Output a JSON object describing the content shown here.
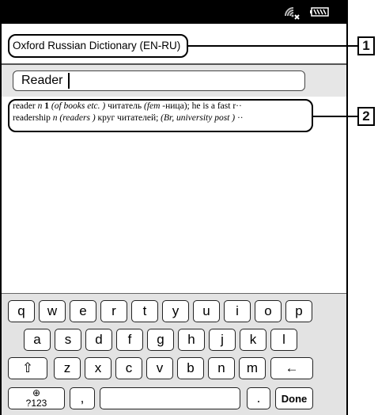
{
  "status_bar": {
    "wifi_icon": "wifi-off-icon",
    "battery_icon": "battery-icon"
  },
  "dictionary": {
    "title": "Oxford Russian Dictionary (EN-RU)"
  },
  "search": {
    "value": "Reader"
  },
  "results": [
    {
      "headword": "reader",
      "pos": "n",
      "sense": "1",
      "gloss_italic_1": "(of books etc. )",
      "translation": "читатель",
      "gloss_italic_2": "(fem",
      "form": "-ница);",
      "rest": "he is a fast r",
      "ellipsis": "··"
    },
    {
      "headword": "readership",
      "pos": "n",
      "gloss_italic_1": "(readers )",
      "translation": "круг читателей;",
      "gloss_italic_2": "(Br, university post )",
      "ellipsis": "··"
    }
  ],
  "keyboard": {
    "row1": [
      "q",
      "w",
      "e",
      "r",
      "t",
      "y",
      "u",
      "i",
      "o",
      "p"
    ],
    "row2": [
      "a",
      "s",
      "d",
      "f",
      "g",
      "h",
      "j",
      "k",
      "l"
    ],
    "row3_letters": [
      "z",
      "x",
      "c",
      "v",
      "b",
      "n",
      "m"
    ],
    "shift_label": "⇧",
    "backspace_label": "←",
    "symbols_label": "?123",
    "globe_label": "⊕",
    "comma_label": ",",
    "period_label": ".",
    "done_label": "Done"
  },
  "callouts": {
    "one": "1",
    "two": "2"
  }
}
